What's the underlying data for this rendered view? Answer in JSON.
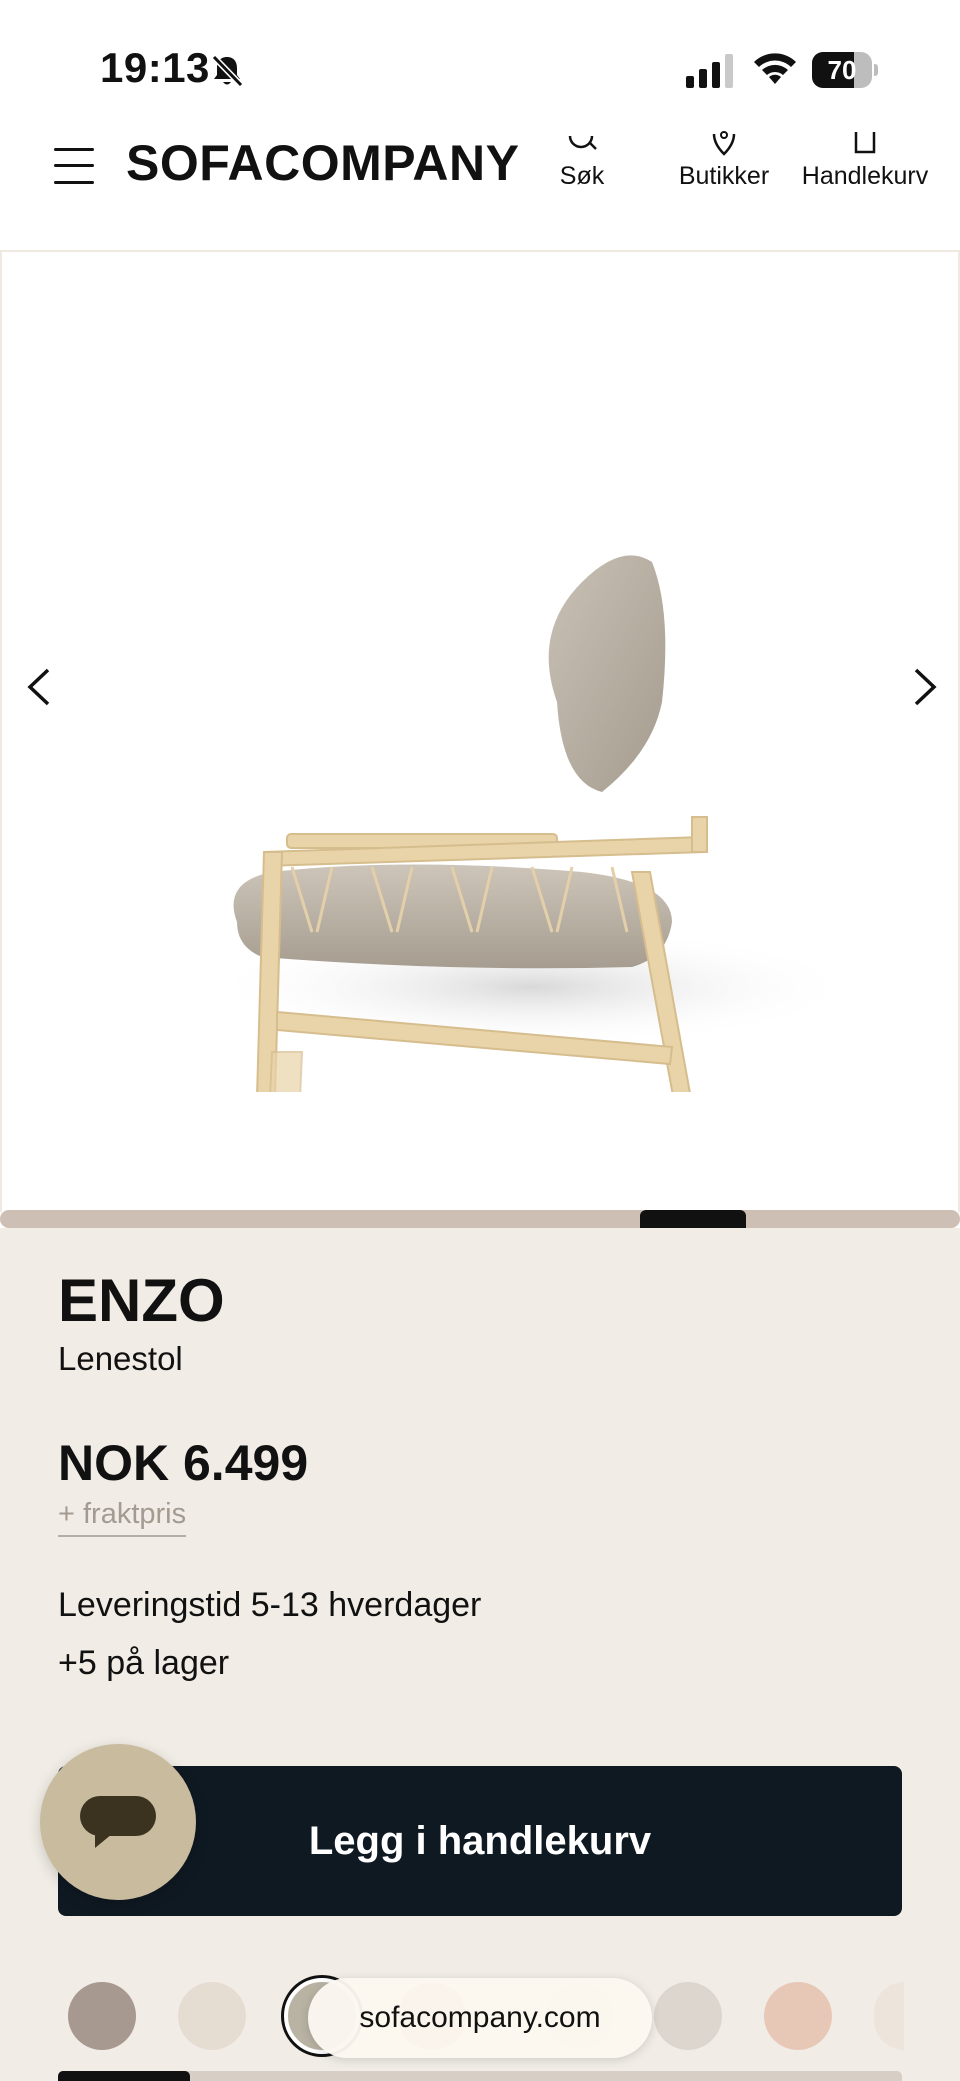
{
  "status_bar": {
    "time": "19:13",
    "battery": "70",
    "battery_level": 0.7,
    "icons": [
      "bell-slash-icon",
      "cellular-signal-icon",
      "wifi-icon",
      "battery-icon"
    ]
  },
  "header": {
    "brand": "SOFACOMPANY",
    "nav": [
      {
        "label": "Søk",
        "icon": "search-icon"
      },
      {
        "label": "Butikker",
        "icon": "location-pin-icon"
      },
      {
        "label": "Handlekurv",
        "icon": "shopping-bag-icon"
      }
    ]
  },
  "gallery": {
    "image": "chair-product-image",
    "icons": [
      "chevron-left-icon",
      "chevron-right-icon"
    ]
  },
  "product": {
    "title": "ENZO",
    "subtitle": "Lenestol",
    "price": "NOK 6.499",
    "shipping_link": "+ fraktpris",
    "delivery": "Leveringstid 5-13 hverdager",
    "stock": "+5  på lager",
    "add_to_cart": "Legg i handlekurv"
  },
  "browser": {
    "url": "sofacompany.com"
  },
  "colors": {
    "accent_dark": "#0f1922",
    "background_info": "#f1ede6",
    "chat_button": "#c8bb9e"
  }
}
